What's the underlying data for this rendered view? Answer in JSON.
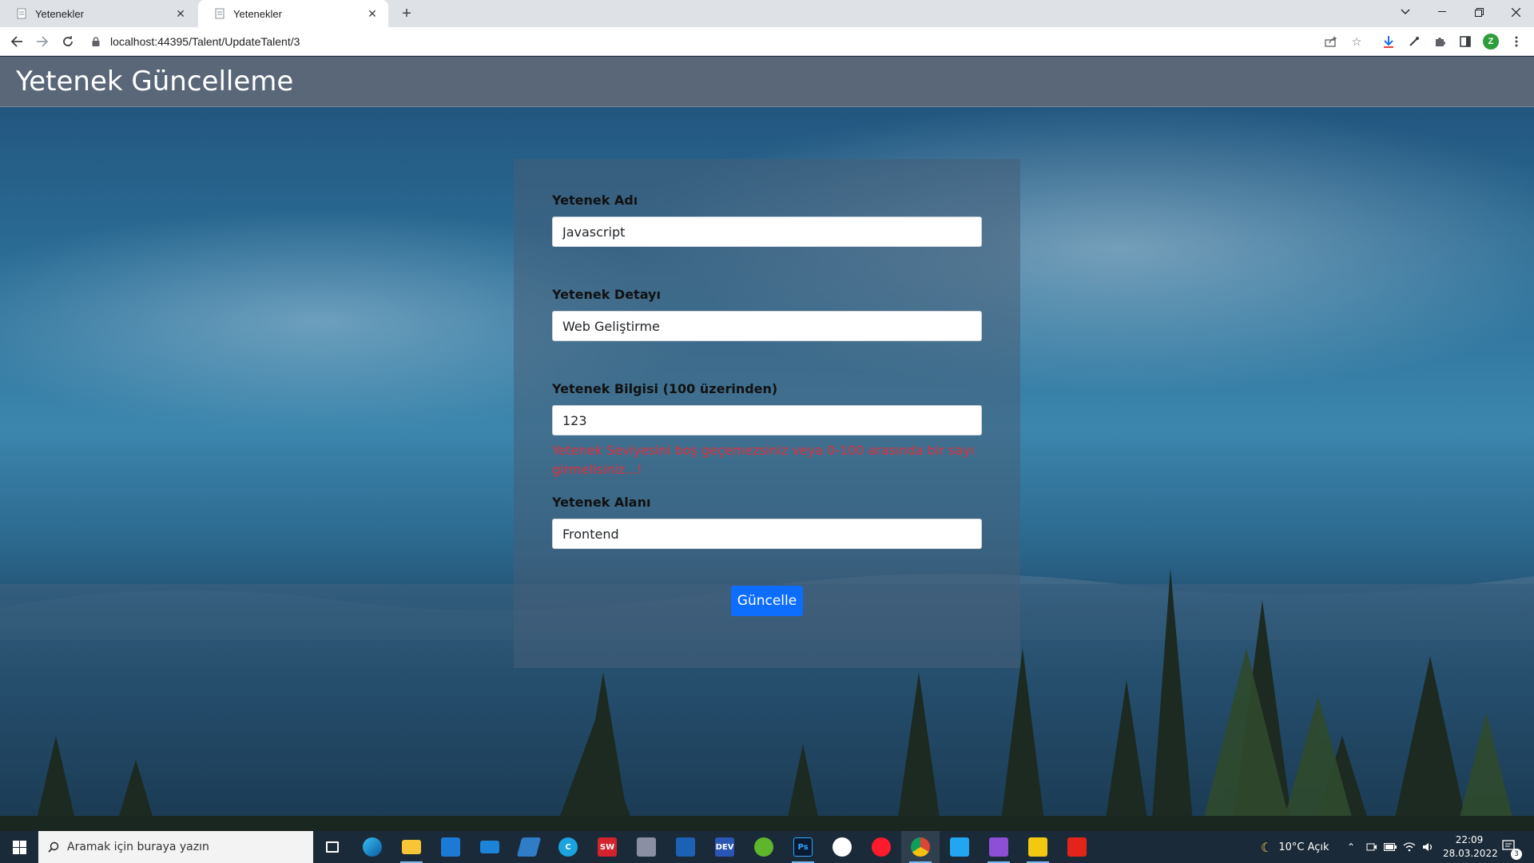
{
  "browser": {
    "tabs": [
      {
        "title": "Yetenekler",
        "active": false
      },
      {
        "title": "Yetenekler",
        "active": true
      }
    ],
    "url": "localhost:44395/Talent/UpdateTalent/3",
    "profile_initial": "Z"
  },
  "page": {
    "title": "Yetenek Güncelleme",
    "form": {
      "fields": [
        {
          "label": "Yetenek Adı",
          "value": "Javascript"
        },
        {
          "label": "Yetenek Detayı",
          "value": "Web Geliştirme"
        },
        {
          "label": "Yetenek Bilgisi (100 üzerinden)",
          "value": "123",
          "error": "Yetenek Seviyesini boş geçemezsiniz veya 0-100 arasında bir sayı girmelisiniz...!"
        },
        {
          "label": "Yetenek Alanı",
          "value": "Frontend"
        }
      ],
      "submit_label": "Güncelle"
    },
    "colors": {
      "header": "#5a6778",
      "button": "#0d6efd",
      "error": "#e0303c"
    }
  },
  "taskbar": {
    "search_placeholder": "Aramak için buraya yazın",
    "apps": [
      "task-view",
      "edge",
      "file-explorer",
      "microsoft-store",
      "mail",
      "azure-data-studio",
      "ccleaner",
      "solidworks",
      "sql-server-management-studio",
      "virtualbox",
      "dev-cpp",
      "app-green",
      "photoshop",
      "app-circle",
      "opera",
      "chrome",
      "vscode",
      "visual-studio",
      "power-bi",
      "acrobat"
    ],
    "weather": "10°C Açık",
    "time": "22:09",
    "date": "28.03.2022",
    "notification_count": "3"
  }
}
